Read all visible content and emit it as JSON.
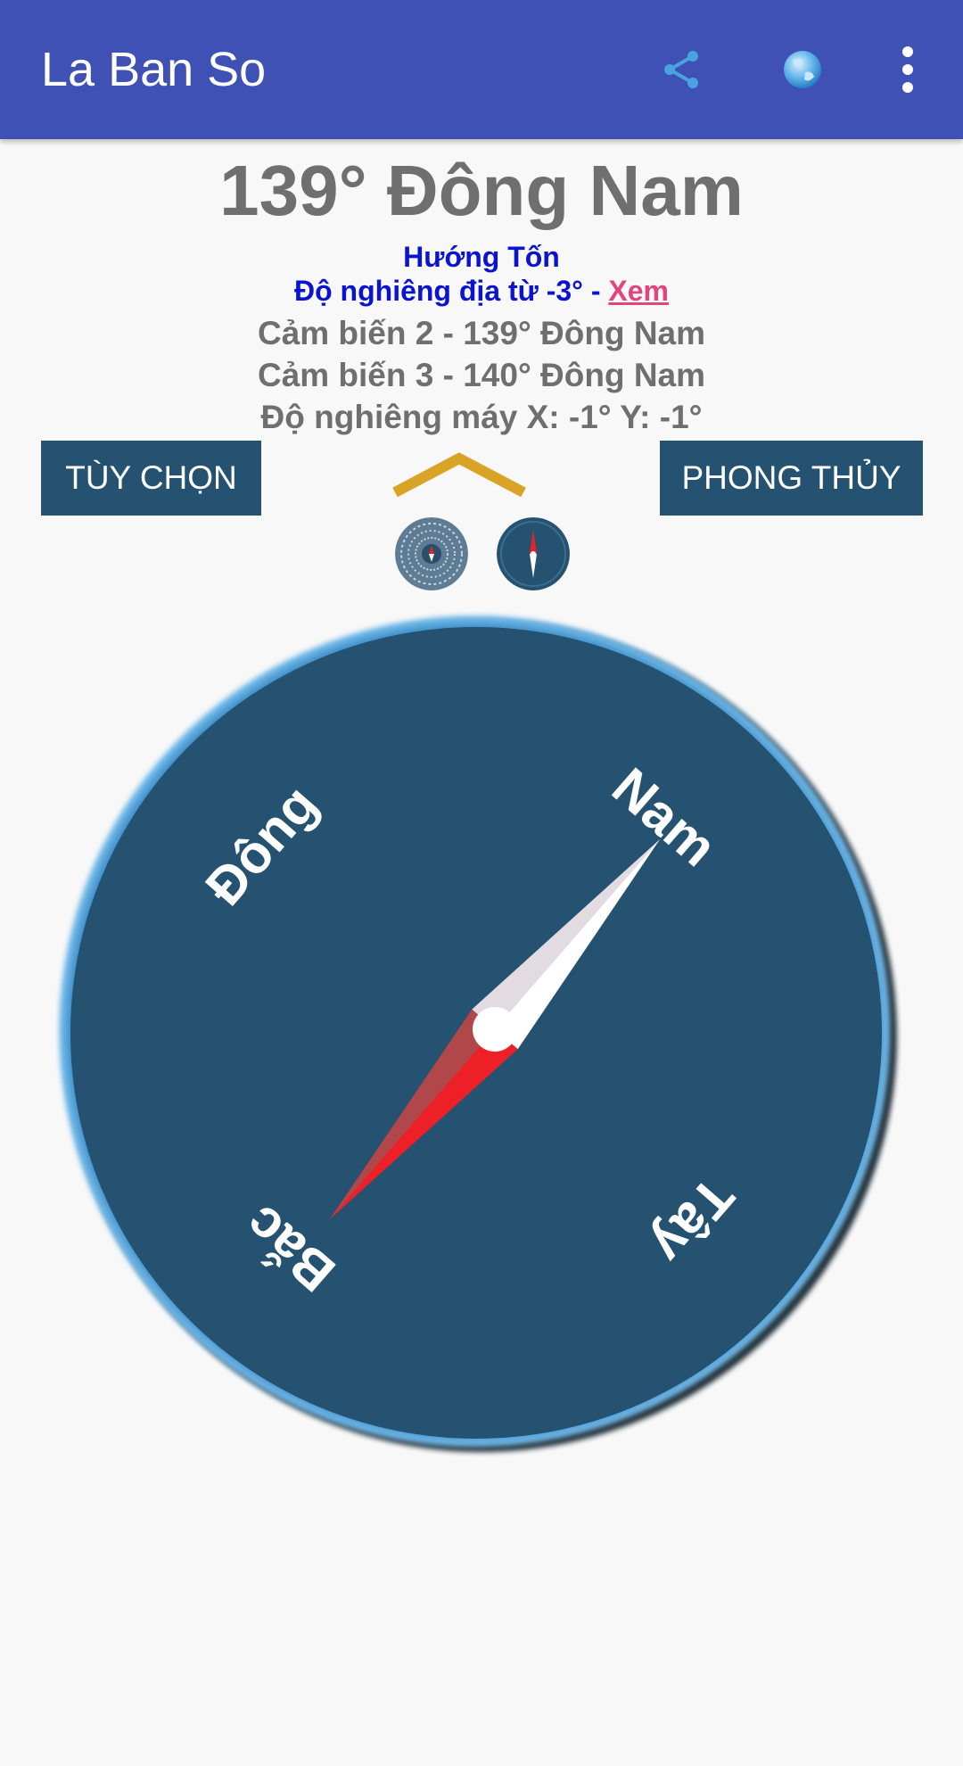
{
  "app": {
    "title": "La Ban So",
    "icons": [
      "share-icon",
      "globe-icon",
      "more-vert-icon"
    ]
  },
  "reading": {
    "heading": "139° Đông Nam",
    "direction": "Hướng Tốn",
    "declination_prefix": "Độ nghiêng địa từ -3° - ",
    "declination_link": "Xem",
    "sensor2": "Cảm biến 2 - 139° Đông Nam",
    "sensor3": "Cảm biến 3 - 140° Đông Nam",
    "tilt": "Độ nghiêng máy X: -1° Y: -1°",
    "bearing_deg": 139
  },
  "buttons": {
    "options": "TÙY CHỌN",
    "fengshui": "PHONG THỦY"
  },
  "compass": {
    "labels": {
      "north": "Bắc",
      "east": "Đông",
      "south": "Nam",
      "west": "Tây"
    }
  },
  "colors": {
    "appbar": "#3f51b5",
    "dial": "#245270",
    "button": "#245270",
    "needle_north": "#ee2027",
    "needle_south": "#ffffff",
    "chevron": "#d9a426",
    "link": "#e0457b",
    "info_blue": "#0a14d0"
  }
}
